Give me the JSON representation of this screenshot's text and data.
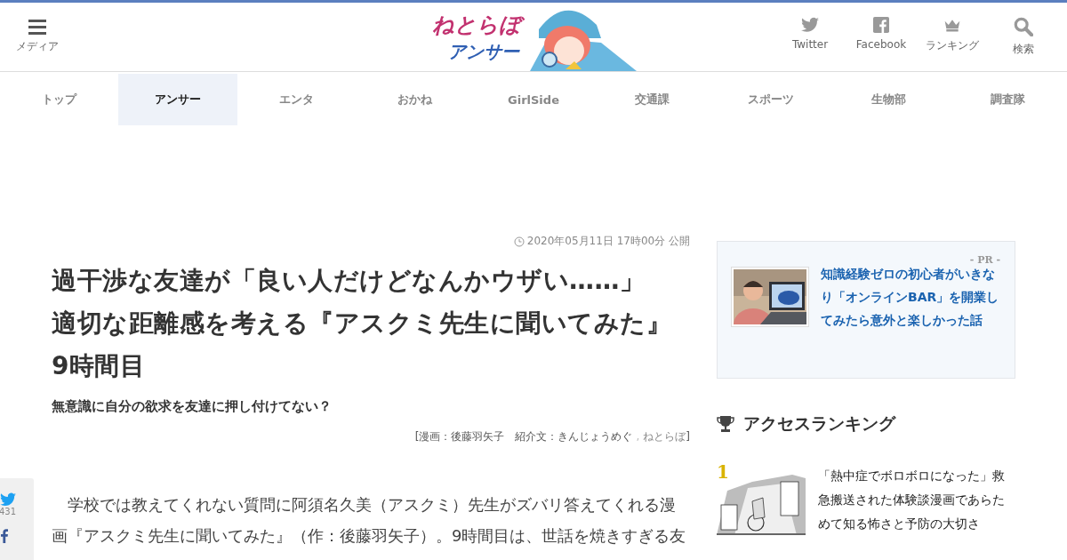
{
  "header": {
    "menu_label": "メディア",
    "logo": {
      "line_1": "ねとらぼ",
      "line_2": "アンサー"
    },
    "actions": [
      {
        "kind": "twitter",
        "label": "Twitter"
      },
      {
        "kind": "facebook",
        "label": "Facebook"
      },
      {
        "kind": "ranking",
        "label": "ランキング"
      },
      {
        "kind": "search",
        "label": "検索"
      }
    ]
  },
  "nav": [
    {
      "label": "トップ",
      "selected": false
    },
    {
      "label": "アンサー",
      "selected": true
    },
    {
      "label": "エンタ",
      "selected": false
    },
    {
      "label": "おかね",
      "selected": false
    },
    {
      "label": "GirlSide",
      "selected": false
    },
    {
      "label": "交通課",
      "selected": false
    },
    {
      "label": "スポーツ",
      "selected": false
    },
    {
      "label": "生物部",
      "selected": false
    },
    {
      "label": "調査隊",
      "selected": false
    }
  ],
  "article": {
    "date": "2020年05月11日 17時00分 公開",
    "title_lines": [
      "過干渉な友達が「良い人だけどなんかウザい……」",
      "適切な距離感を考える『アスクミ先生に聞いてみた』",
      "9時間目"
    ],
    "subtitle": "無意識に自分の欲求を友達に押し付けてない？",
    "credit": "[漫画：後藤羽矢子　紹介文：きんじょうめぐ",
    "credit_sep": ",",
    "credit_link": "ねとらぼ",
    "credit_end": "]",
    "body_lines": [
      "学校では教えてくれない質問に阿須名久美（アスクミ）先生がズバリ答えてくれる漫",
      "画『アスクミ先生に聞いてみた』（作：後藤羽矢子）。9時間目は、世話を焼きすぎる友"
    ]
  },
  "share": {
    "twitter_count": "431"
  },
  "pr": {
    "label": "- PR -",
    "title": "知識経験ゼロの初心者がいきなり「オンラインBAR」を開業してみたら意外と楽しかった話"
  },
  "ranking": {
    "heading": "アクセスランキング",
    "items": [
      {
        "rank": "1",
        "title": "「熱中症でボロボロになった」救急搬送された体験談漫画であらためて知る怖さと予防の大切さ"
      }
    ]
  }
}
